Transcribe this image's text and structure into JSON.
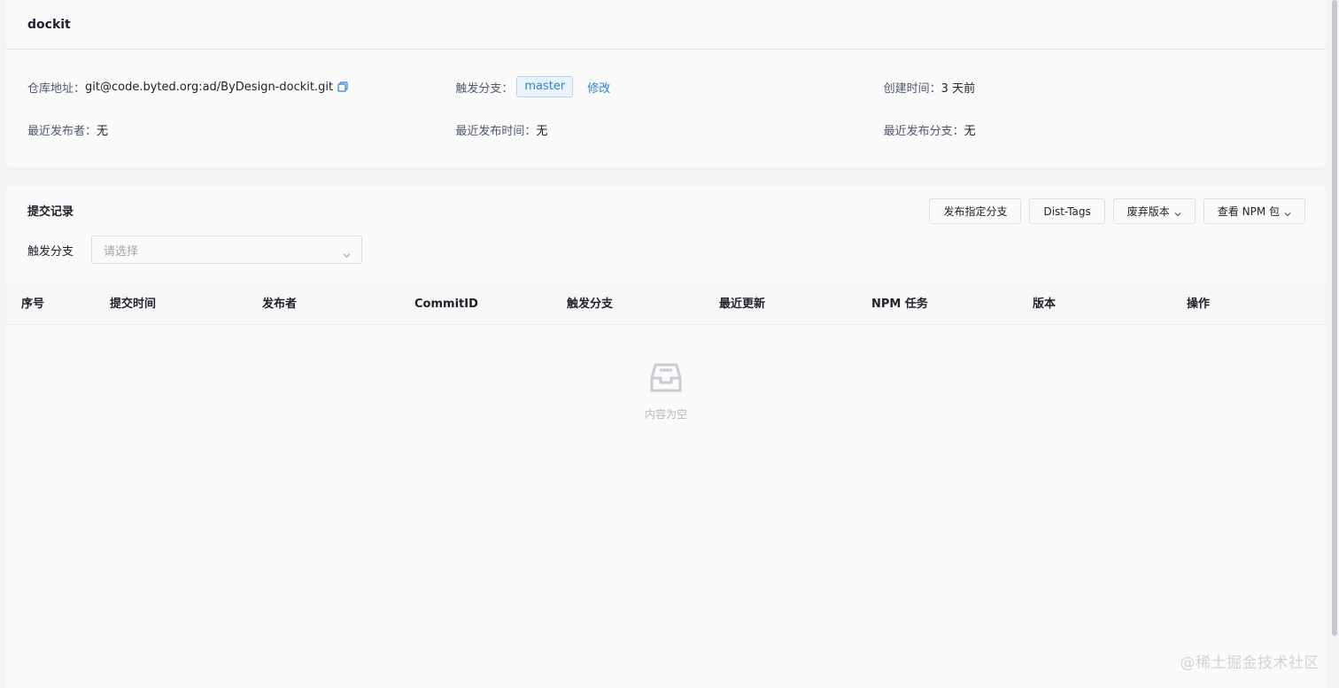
{
  "app": {
    "title": "dockit"
  },
  "info": {
    "repo_label": "仓库地址：",
    "repo_value": "git@code.byted.org:ad/ByDesign-dockit.git",
    "branch_label": "触发分支：",
    "branch_value": "master",
    "edit_label": "修改",
    "created_label": "创建时间：",
    "created_value": "3 天前",
    "publisher_label": "最近发布者：",
    "publisher_value": "无",
    "publish_time_label": "最近发布时间：",
    "publish_time_value": "无",
    "publish_branch_label": "最近发布分支：",
    "publish_branch_value": "无"
  },
  "commits": {
    "title": "提交记录",
    "toolbar": {
      "publish_branch": "发布指定分支",
      "dist_tags": "Dist-Tags",
      "deprecate": "废弃版本",
      "view_npm": "查看 NPM 包"
    },
    "filter": {
      "label": "触发分支",
      "placeholder": "请选择"
    },
    "columns": [
      "序号",
      "提交时间",
      "发布者",
      "CommitID",
      "触发分支",
      "最近更新",
      "NPM 任务",
      "版本",
      "操作"
    ],
    "empty_text": "内容为空"
  },
  "watermark": "@稀土掘金技术社区",
  "colors": {
    "accent": "#2f7fd8",
    "tag_bg": "#eaf3fd",
    "tag_border": "#b6d4f5"
  }
}
